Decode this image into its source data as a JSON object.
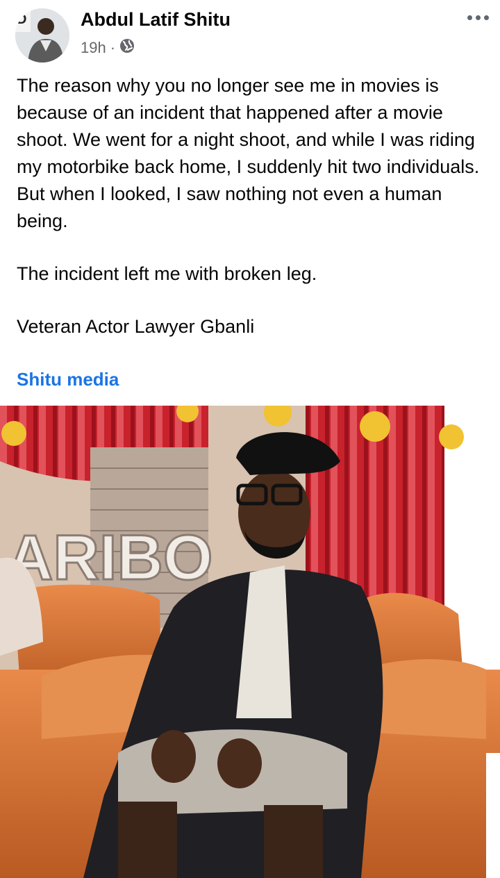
{
  "post": {
    "author": "Abdul Latif Shitu",
    "time": "19h",
    "separator": "·",
    "privacy_icon": "globe-icon",
    "more_icon": "more-horizontal-icon",
    "paragraphs": [
      "The reason why you no longer see me in movies is because of an incident that happened after a movie shoot. We went for a night shoot, and while I was riding my motorbike back home, I suddenly hit two individuals. But when I looked, I saw nothing not even a human being.",
      "The incident left me with broken leg.",
      "Veteran Actor Lawyer Gbanli"
    ],
    "link_text": "Shitu media",
    "photo_sign_text": "ARIBO"
  },
  "colors": {
    "text": "#050505",
    "secondary": "#65676b",
    "link": "#1b74e4",
    "curtain": "#c0212a",
    "sofa": "#d9783a"
  }
}
